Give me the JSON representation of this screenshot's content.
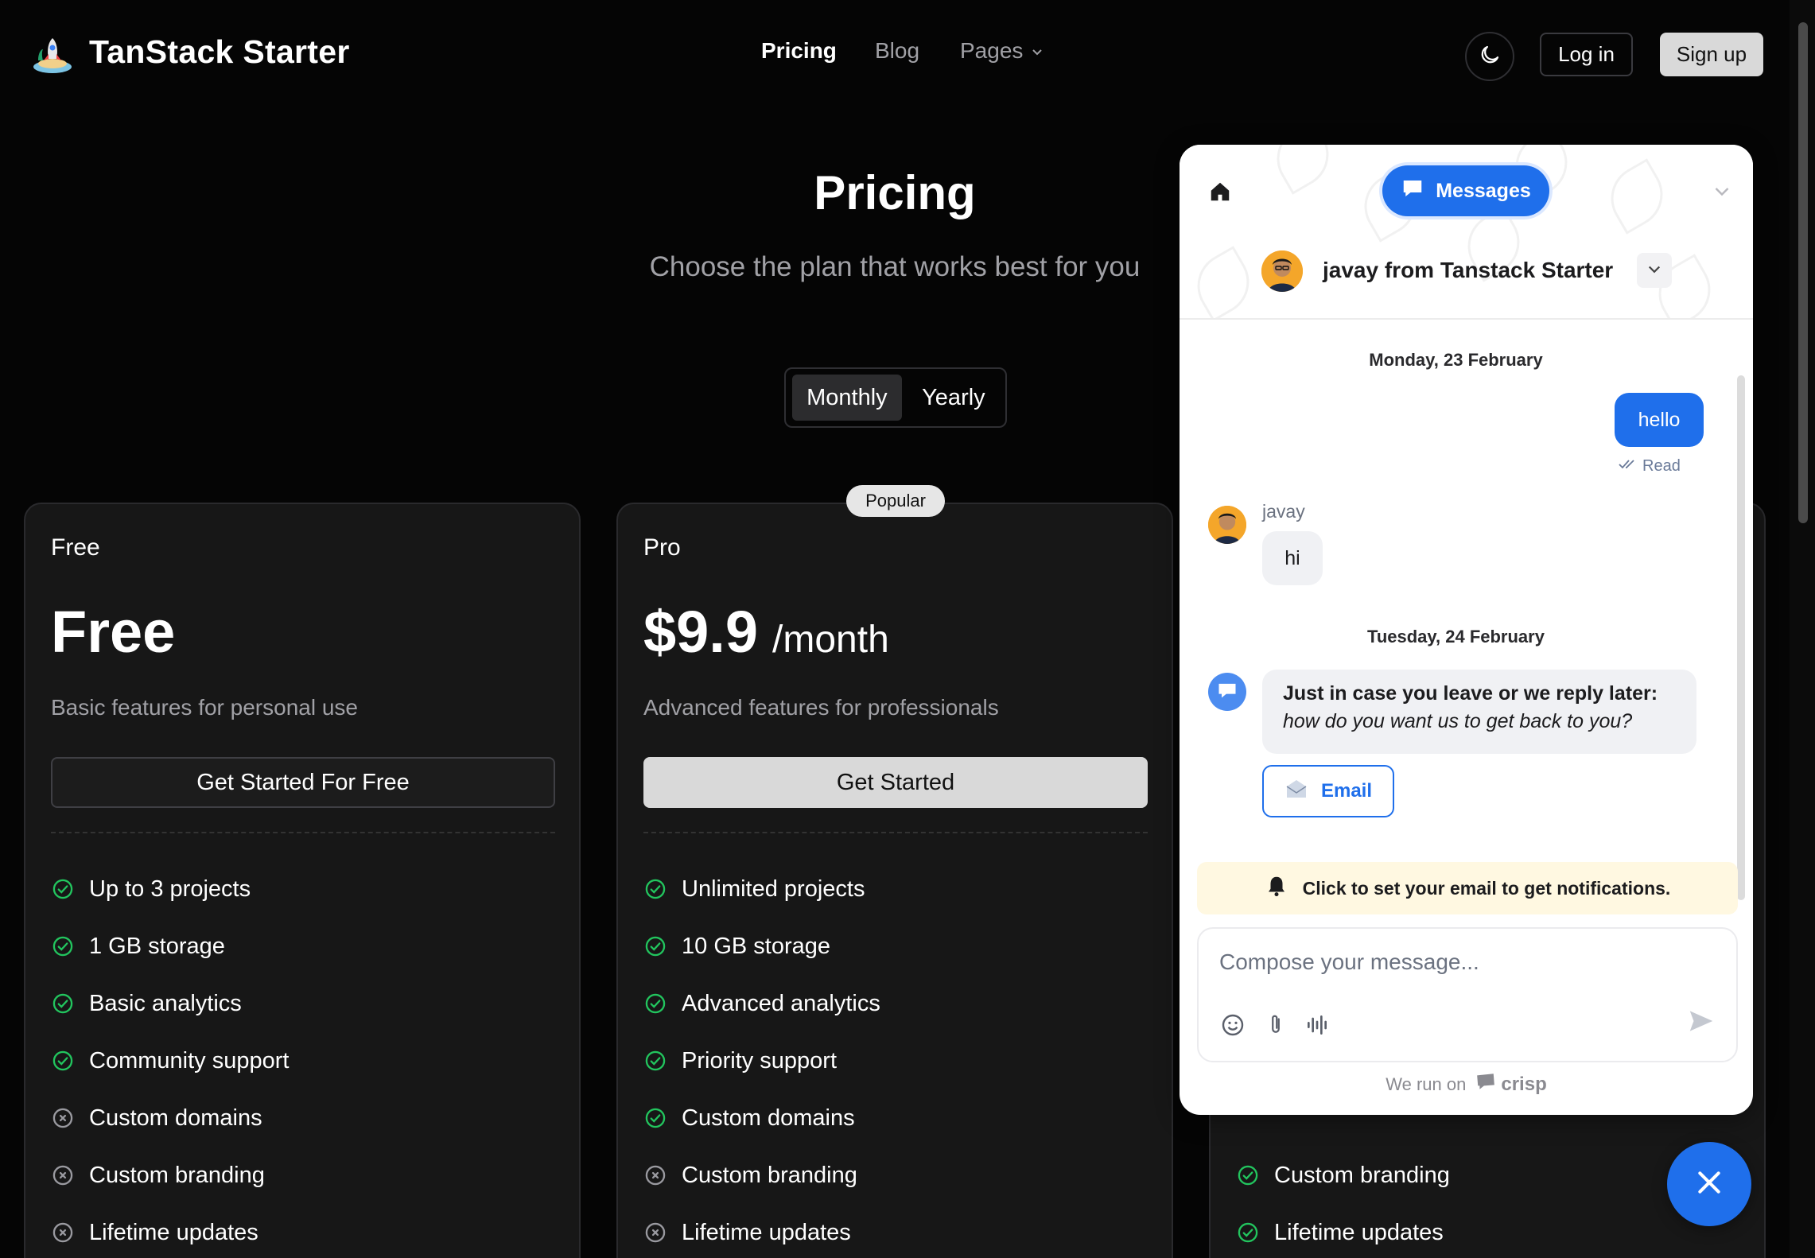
{
  "header": {
    "logo_text": "TanStack Starter",
    "nav": {
      "pricing": "Pricing",
      "blog": "Blog",
      "pages": "Pages"
    },
    "login": "Log in",
    "signup": "Sign up"
  },
  "hero": {
    "title": "Pricing",
    "subtitle": "Choose the plan that works best for you",
    "toggle": {
      "monthly": "Monthly",
      "yearly": "Yearly",
      "selected": "Monthly"
    }
  },
  "plans": [
    {
      "name": "Free",
      "price": "Free",
      "description": "Basic features for personal use",
      "cta": "Get Started For Free",
      "features": [
        {
          "label": "Up to 3 projects",
          "included": true
        },
        {
          "label": "1 GB storage",
          "included": true
        },
        {
          "label": "Basic analytics",
          "included": true
        },
        {
          "label": "Community support",
          "included": true
        },
        {
          "label": "Custom domains",
          "included": false
        },
        {
          "label": "Custom branding",
          "included": false
        },
        {
          "label": "Lifetime updates",
          "included": false
        }
      ]
    },
    {
      "name": "Pro",
      "badge": "Popular",
      "price": "$9.9",
      "unit": "/month",
      "description": "Advanced features for professionals",
      "cta": "Get Started",
      "features": [
        {
          "label": "Unlimited projects",
          "included": true
        },
        {
          "label": "10 GB storage",
          "included": true
        },
        {
          "label": "Advanced analytics",
          "included": true
        },
        {
          "label": "Priority support",
          "included": true
        },
        {
          "label": "Custom domains",
          "included": true
        },
        {
          "label": "Custom branding",
          "included": false
        },
        {
          "label": "Lifetime updates",
          "included": false
        }
      ]
    },
    {
      "features_visible": [
        {
          "label": "Custom branding",
          "included": true
        },
        {
          "label": "Lifetime updates",
          "included": true
        }
      ]
    }
  ],
  "chat": {
    "tab_label": "Messages",
    "agent_title": "javay from Tanstack Starter",
    "date_1": "Monday, 23 February",
    "outgoing_message": "hello",
    "read_status": "Read",
    "sender_name": "javay",
    "incoming_message": "hi",
    "date_2": "Tuesday, 24 February",
    "bot_line_1": "Just in case you leave or we reply later:",
    "bot_line_2": "how do you want us to get back to you?",
    "email_button": "Email",
    "notify_text": "Click to set your email to get notifications.",
    "compose_placeholder": "Compose your message...",
    "powered_prefix": "We run on",
    "powered_brand": "crisp"
  },
  "colors": {
    "accent_blue": "#1f6feb",
    "check_green": "#22c55e",
    "muted_text": "#a1a1a6",
    "background": "#050505"
  },
  "icons": [
    "logo-icon",
    "chevron-down-icon",
    "moon-icon",
    "check-circle-icon",
    "x-circle-icon",
    "home-icon",
    "chat-bubble-icon",
    "bell-icon",
    "emoji-icon",
    "paperclip-icon",
    "audio-wave-icon",
    "send-icon",
    "close-icon",
    "double-check-icon"
  ]
}
